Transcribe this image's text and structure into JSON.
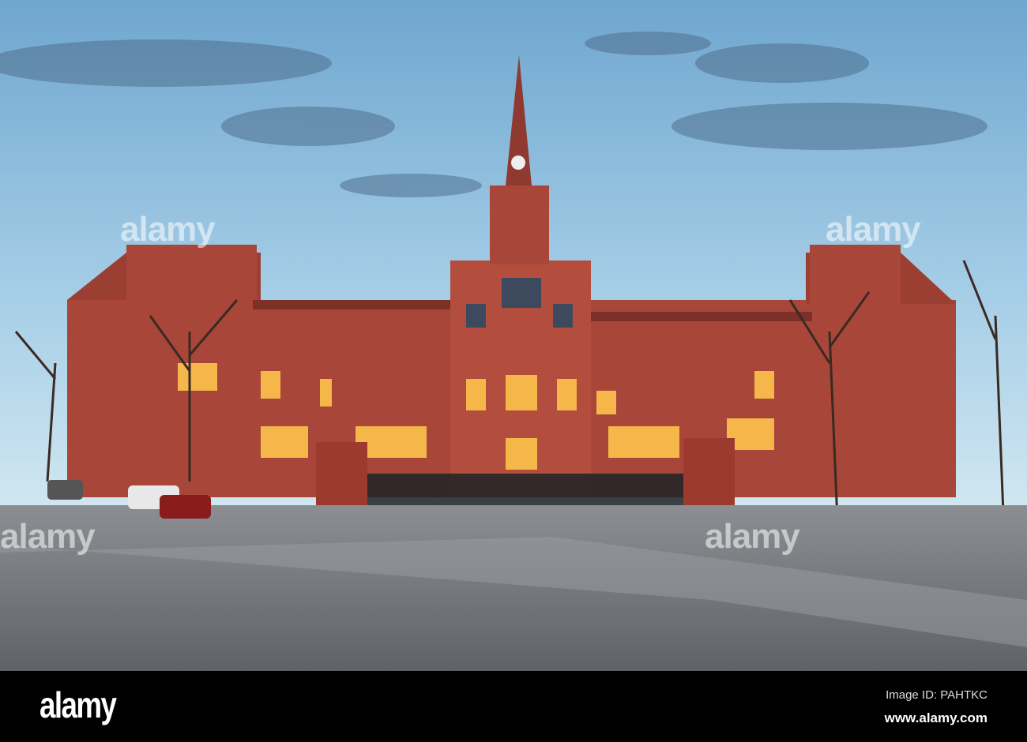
{
  "watermark": {
    "text": "alamy"
  },
  "footer": {
    "logo": "alamy",
    "image_id": "Image ID: PAHTKC",
    "website": "www.alamy.com"
  },
  "colors": {
    "sky_top": "#6fa6cf",
    "sky_bottom": "#c9e3f0",
    "brick": "#a8463a",
    "road": "#6c6f73",
    "window_glow": "#f5b64a"
  }
}
